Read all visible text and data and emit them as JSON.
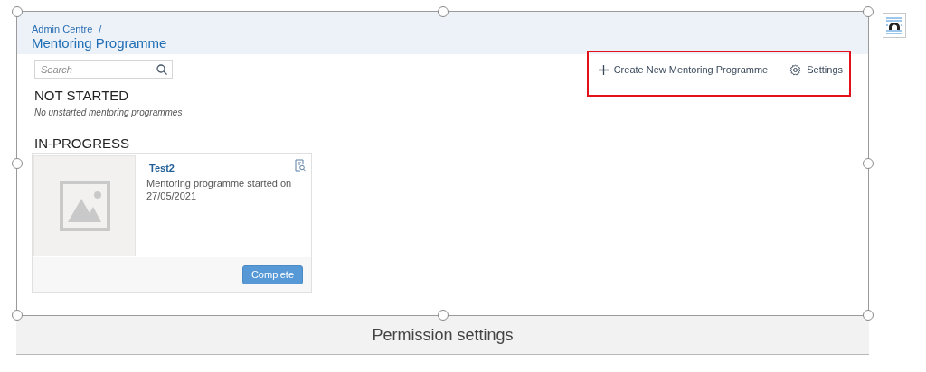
{
  "figure": {
    "selected": true,
    "caption": "Permission settings"
  },
  "breadcrumb": {
    "parent": "Admin Centre",
    "separator": "/"
  },
  "title": "Mentoring Programme",
  "search": {
    "placeholder": "Search"
  },
  "toolbar": {
    "highlighted": true,
    "actions": [
      {
        "kind": "create",
        "label": "Create New Mentoring Programme"
      },
      {
        "kind": "settings",
        "label": "Settings"
      }
    ]
  },
  "sections": [
    {
      "heading": "NOT STARTED",
      "empty_text": "No unstarted mentoring programmes"
    },
    {
      "heading": "IN-PROGRESS",
      "cards": [
        {
          "title": "Test2",
          "description": "Mentoring programme started on 27/05/2021",
          "button": "Complete"
        }
      ]
    }
  ]
}
